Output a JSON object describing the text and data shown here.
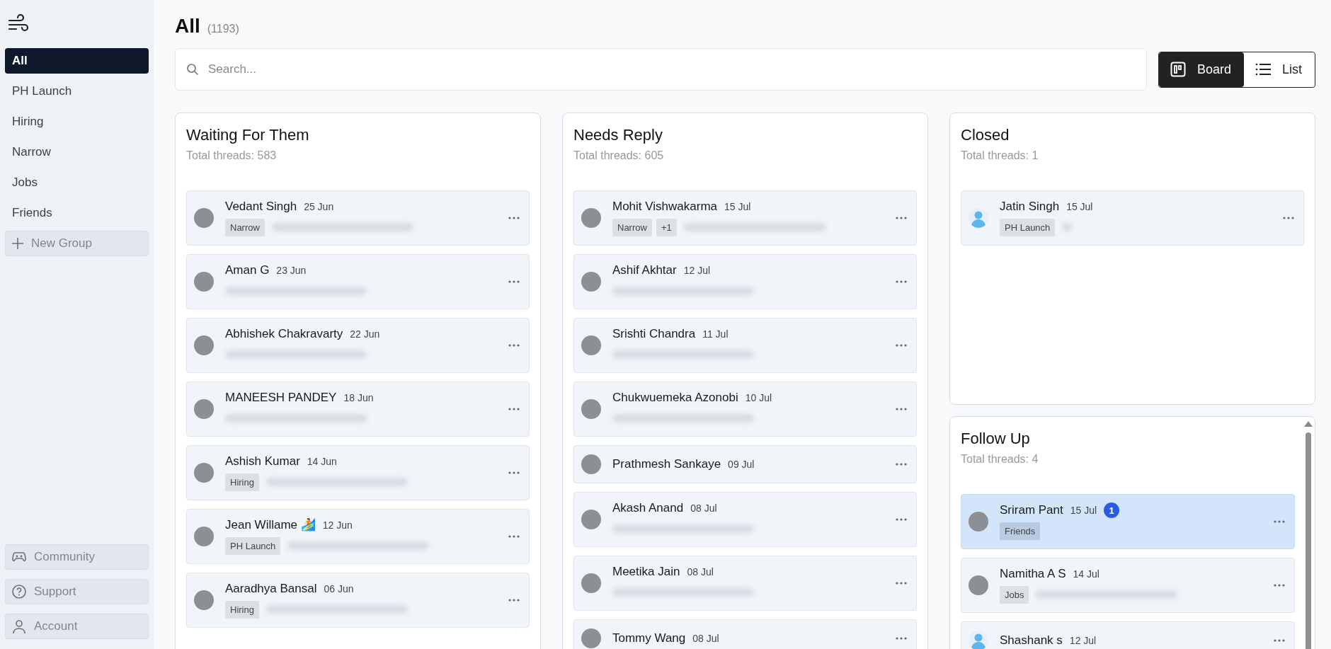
{
  "sidebar": {
    "groups": [
      {
        "label": "All",
        "selected": true
      },
      {
        "label": "PH Launch",
        "selected": false
      },
      {
        "label": "Hiring",
        "selected": false
      },
      {
        "label": "Narrow",
        "selected": false
      },
      {
        "label": "Jobs",
        "selected": false
      },
      {
        "label": "Friends",
        "selected": false
      }
    ],
    "new_group": "New Group",
    "footer": [
      {
        "kind": "community",
        "label": "Community"
      },
      {
        "kind": "support",
        "label": "Support"
      },
      {
        "kind": "account",
        "label": "Account"
      }
    ]
  },
  "header": {
    "title": "All",
    "count": "(1193)"
  },
  "search": {
    "placeholder": "Search..."
  },
  "views": [
    {
      "kind": "board",
      "label": "Board",
      "selected": true
    },
    {
      "kind": "list",
      "label": "List",
      "selected": false
    }
  ],
  "columns": [
    {
      "title": "Waiting For Them",
      "subtitle": "Total threads: 583",
      "threads": [
        {
          "name": "Vedant Singh",
          "date": "25 Jun",
          "default_avatar": false,
          "tags": [
            "Narrow"
          ],
          "preview": true,
          "selected": false
        },
        {
          "name": "Aman G",
          "date": "23 Jun",
          "default_avatar": false,
          "preview": true,
          "selected": false
        },
        {
          "name": "Abhishek Chakravarty",
          "date": "22 Jun",
          "default_avatar": false,
          "preview": true,
          "selected": false
        },
        {
          "name": "MANEESH PANDEY",
          "date": "18 Jun",
          "default_avatar": false,
          "preview": true,
          "selected": false
        },
        {
          "name": "Ashish Kumar",
          "date": "14 Jun",
          "default_avatar": false,
          "tags": [
            "Hiring"
          ],
          "preview": true,
          "selected": false
        },
        {
          "name": "Jean Willame 🏄",
          "date": "12 Jun",
          "default_avatar": false,
          "tags": [
            "PH Launch"
          ],
          "preview": true,
          "selected": false
        },
        {
          "name": "Aaradhya Bansal",
          "date": "06 Jun",
          "default_avatar": false,
          "tags": [
            "Hiring"
          ],
          "preview": true,
          "selected": false
        }
      ]
    },
    {
      "title": "Needs Reply",
      "subtitle": "Total threads: 605",
      "threads": [
        {
          "name": "Mohit Vishwakarma",
          "date": "15 Jul",
          "default_avatar": false,
          "tags": [
            "Narrow",
            "+1"
          ],
          "preview": true,
          "selected": false
        },
        {
          "name": "Ashif Akhtar",
          "date": "12 Jul",
          "default_avatar": false,
          "preview": true,
          "selected": false
        },
        {
          "name": "Srishti Chandra",
          "date": "11 Jul",
          "default_avatar": false,
          "preview": true,
          "selected": false
        },
        {
          "name": "Chukwuemeka Azonobi",
          "date": "10 Jul",
          "default_avatar": false,
          "preview": true,
          "selected": false
        },
        {
          "name": "Prathmesh Sankaye",
          "date": "09 Jul",
          "default_avatar": false,
          "preview": false,
          "selected": false
        },
        {
          "name": "Akash Anand",
          "date": "08 Jul",
          "default_avatar": false,
          "preview": true,
          "selected": false
        },
        {
          "name": "Meetika Jain",
          "date": "08 Jul",
          "default_avatar": false,
          "preview": true,
          "selected": false
        },
        {
          "name": "Tommy Wang",
          "date": "08 Jul",
          "default_avatar": false,
          "selected": false
        }
      ]
    },
    {
      "title": "Closed",
      "subtitle": "Total threads: 1",
      "threads": [
        {
          "name": "Jatin Singh",
          "date": "15 Jul",
          "default_avatar": true,
          "tags": [
            "PH Launch"
          ],
          "preview": true,
          "selected": false
        }
      ]
    },
    {
      "title": "Follow Up",
      "subtitle": "Total threads: 4",
      "threads": [
        {
          "name": "Sriram Pant",
          "date": "15 Jul",
          "default_avatar": false,
          "unread": "1",
          "tags": [
            "Friends"
          ],
          "preview": false,
          "selected": true
        },
        {
          "name": "Namitha A S",
          "date": "14 Jul",
          "default_avatar": false,
          "tags": [
            "Jobs"
          ],
          "preview": true,
          "selected": false
        },
        {
          "name": "Shashank s",
          "date": "12 Jul",
          "default_avatar": true,
          "selected": false
        }
      ]
    }
  ]
}
